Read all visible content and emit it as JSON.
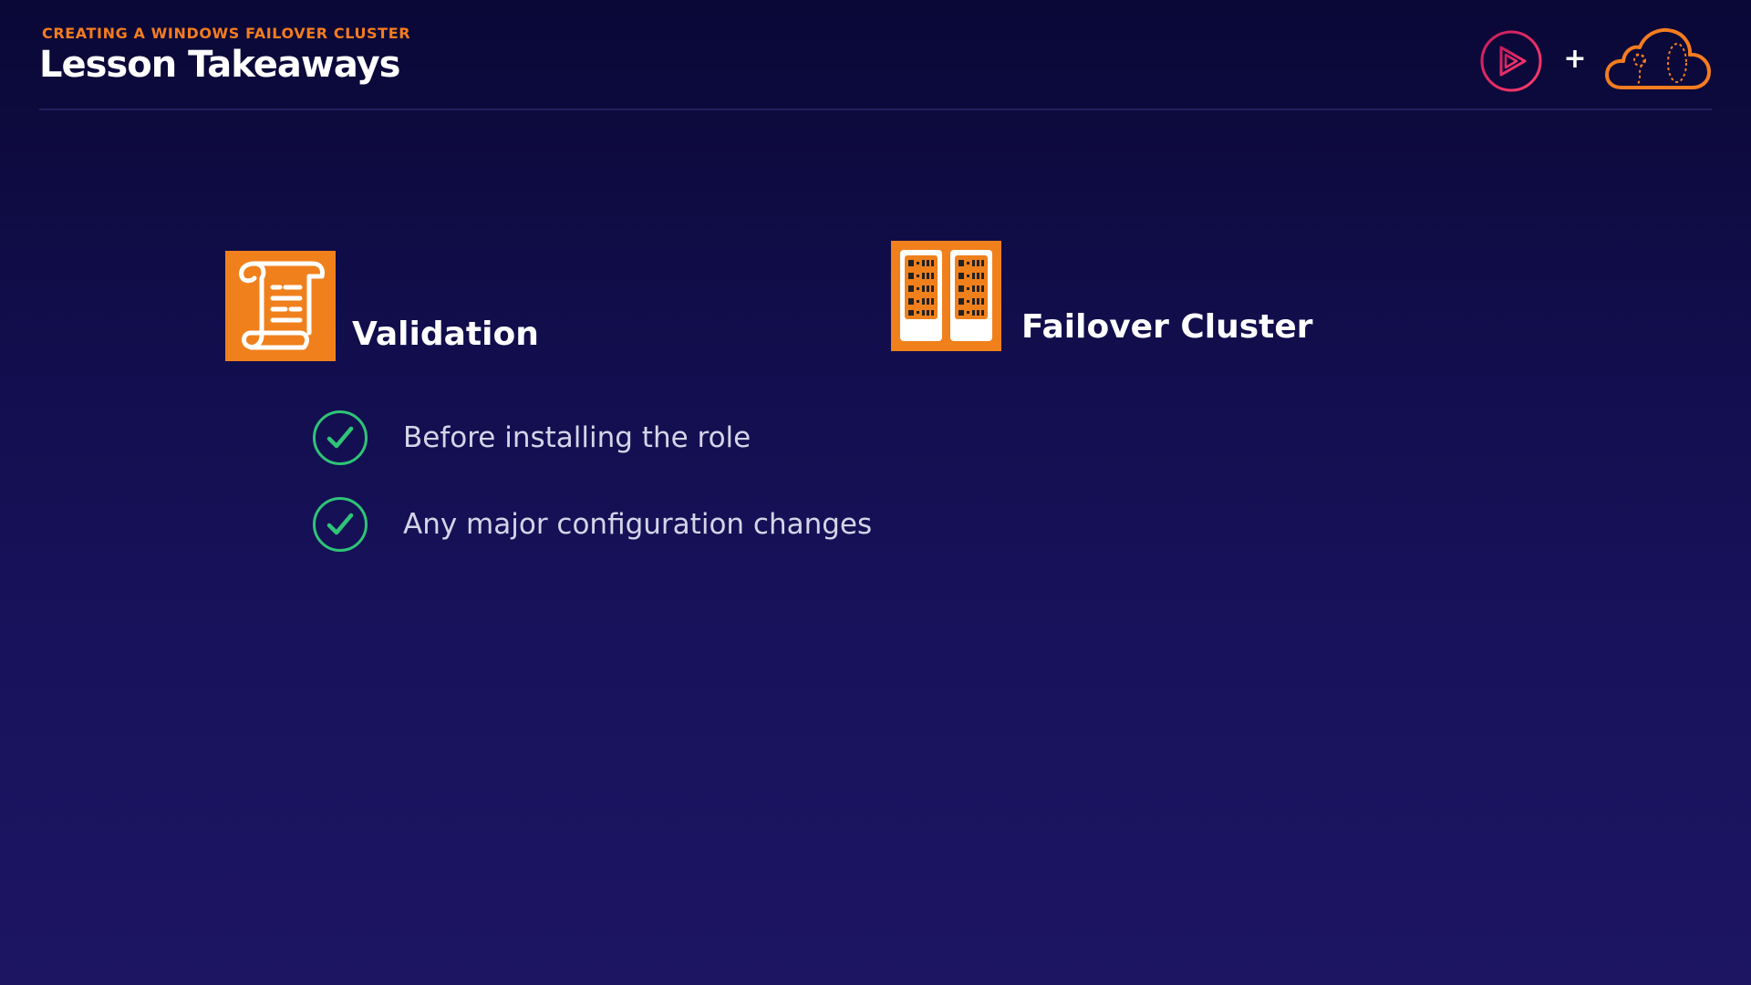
{
  "header": {
    "eyebrow": "CREATING A WINDOWS FAILOVER CLUSTER",
    "title": "Lesson Takeaways",
    "plus": "+"
  },
  "logos": {
    "left": "pluralsight-play-logo",
    "right": "cloud-academy-logo"
  },
  "sections": [
    {
      "label": "Validation",
      "icon": "scroll-icon",
      "bullets": [
        "Before installing the role",
        "Any major configuration changes"
      ]
    },
    {
      "label": "Failover Cluster",
      "icon": "server-rack-icon",
      "bullets": []
    }
  ],
  "colors": {
    "background_top": "#0a0836",
    "background_bottom": "#1d1562",
    "accent_orange": "#f0801c",
    "eyebrow_orange": "#f47c20",
    "check_green": "#2fc477",
    "play_logo_gradient_start": "#e0245e",
    "play_logo_gradient_end": "#ff3d6e"
  }
}
